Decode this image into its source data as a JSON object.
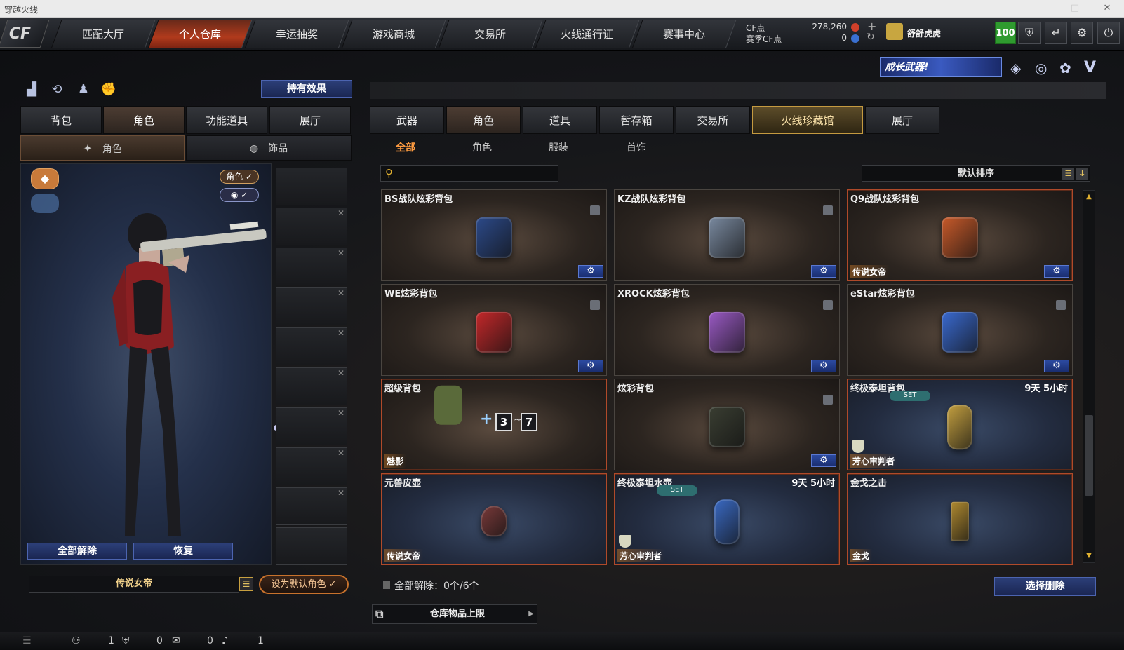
{
  "window": {
    "title": "穿越火线"
  },
  "nav": {
    "tabs": [
      "匹配大厅",
      "个人仓库",
      "幸运抽奖",
      "游戏商城",
      "交易所",
      "火线通行证",
      "赛事中心"
    ],
    "active": 1
  },
  "currency": {
    "cf_label": "CF点",
    "cf_value": "278,260",
    "season_label": "赛季CF点",
    "season_value": "0"
  },
  "player": {
    "name": "舒舒虎虎",
    "level": "100"
  },
  "banner": {
    "text": "成长武器!"
  },
  "left": {
    "effect_button": "持有效果",
    "tabs": [
      "背包",
      "角色",
      "功能道具",
      "展厅"
    ],
    "active_tab": 1,
    "sub_tabs": [
      "角色",
      "饰品"
    ],
    "badges": {
      "role": "角色 ✓",
      "eye": "◉ ✓"
    },
    "unload_all": "全部解除",
    "restore": "恢复",
    "character_name": "传说女帝",
    "set_default": "设为默认角色 ✓"
  },
  "right": {
    "tabs": [
      "武器",
      "角色",
      "道具",
      "暂存箱",
      "交易所",
      "火线珍藏馆",
      "展厅"
    ],
    "active_tab": 1,
    "gold_tab": 5,
    "filters": [
      "全部",
      "角色",
      "服装",
      "首饰"
    ],
    "active_filter": 0,
    "search_placeholder": "",
    "sort_label": "默认排序",
    "items": [
      {
        "name": "BS战队炫彩背包",
        "tag": "",
        "time": "",
        "set": false,
        "color": "#2c4a8a",
        "legend": false
      },
      {
        "name": "KZ战队炫彩背包",
        "tag": "",
        "time": "",
        "set": false,
        "color": "#7a8aa0",
        "legend": false
      },
      {
        "name": "Q9战队炫彩背包",
        "tag": "传说女帝",
        "time": "",
        "set": false,
        "color": "#c85a2a",
        "legend": true
      },
      {
        "name": "WE炫彩背包",
        "tag": "",
        "time": "",
        "set": false,
        "color": "#c4282a",
        "legend": false
      },
      {
        "name": "XROCK炫彩背包",
        "tag": "",
        "time": "",
        "set": false,
        "color": "#9a5ac4",
        "legend": false
      },
      {
        "name": "eStar炫彩背包",
        "tag": "",
        "time": "",
        "set": false,
        "color": "#3a6ad0",
        "legend": false
      },
      {
        "name": "超级背包",
        "tag": "魅影",
        "time": "",
        "set": false,
        "color": "#5a6a3a",
        "legend": true
      },
      {
        "name": "炫彩背包",
        "tag": "",
        "time": "",
        "set": false,
        "color": "#3a3e32",
        "legend": false
      },
      {
        "name": "终极泰坦背包",
        "tag": "芳心审判者",
        "time": "9天 5小时",
        "set": true,
        "color": "#c4a040",
        "legend": true
      },
      {
        "name": "元兽皮壶",
        "tag": "传说女帝",
        "time": "",
        "set": false,
        "color": "#7a3a3a",
        "legend": true
      },
      {
        "name": "终极泰坦水壶",
        "tag": "芳心审判者",
        "time": "9天 5小时",
        "set": true,
        "color": "#3a6ac4",
        "legend": true
      },
      {
        "name": "金戈之击",
        "tag": "金戈",
        "time": "",
        "set": false,
        "color": "#b08a30",
        "legend": true
      }
    ],
    "super_bag_labels": [
      "3",
      "7"
    ],
    "set_label": "SET",
    "unload_status": "全部解除：0个/6个",
    "delete_button": "选择删除",
    "capacity_label": "仓库物品上限"
  },
  "status": {
    "items": [
      "1",
      "0",
      "0",
      "1"
    ]
  }
}
